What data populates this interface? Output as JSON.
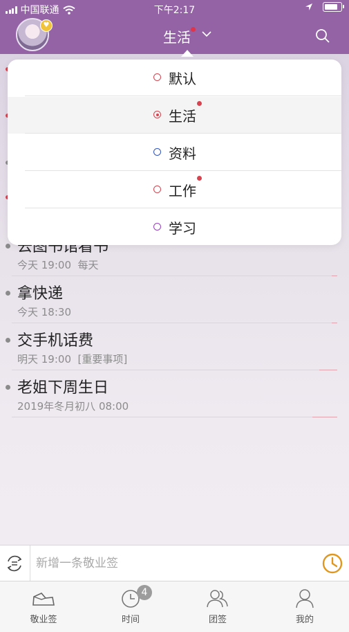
{
  "status_bar": {
    "carrier": "中国联通",
    "time": "下午2:17"
  },
  "header": {
    "title": "生活"
  },
  "dropdown": {
    "items": [
      {
        "label": "默认",
        "color": "#d8434f",
        "selected": false,
        "has_dot": false
      },
      {
        "label": "生活",
        "color": "#d8434f",
        "selected": true,
        "has_dot": true
      },
      {
        "label": "资料",
        "color": "#2f55c4",
        "selected": false,
        "has_dot": false
      },
      {
        "label": "工作",
        "color": "#d8434f",
        "selected": false,
        "has_dot": true
      },
      {
        "label": "学习",
        "color": "#9b3fc4",
        "selected": false,
        "has_dot": false
      }
    ]
  },
  "reminders": [
    {
      "title": "去图书馆看书",
      "sub": "今天 19:00  每天"
    },
    {
      "title": "拿快递",
      "sub": "今天 18:30"
    },
    {
      "title": "交手机话费",
      "sub": "明天 19:00  [重要事项]"
    },
    {
      "title": "老姐下周生日",
      "sub": "2019年冬月初八 08:00"
    }
  ],
  "input": {
    "placeholder": "新增一条敬业签"
  },
  "tabs": [
    {
      "label": "敬业签"
    },
    {
      "label": "时间",
      "badge": "4"
    },
    {
      "label": "团签"
    },
    {
      "label": "我的"
    }
  ],
  "colors": {
    "header": "#9463a5",
    "accent_orange": "#e0971f",
    "red": "#d8434f"
  }
}
